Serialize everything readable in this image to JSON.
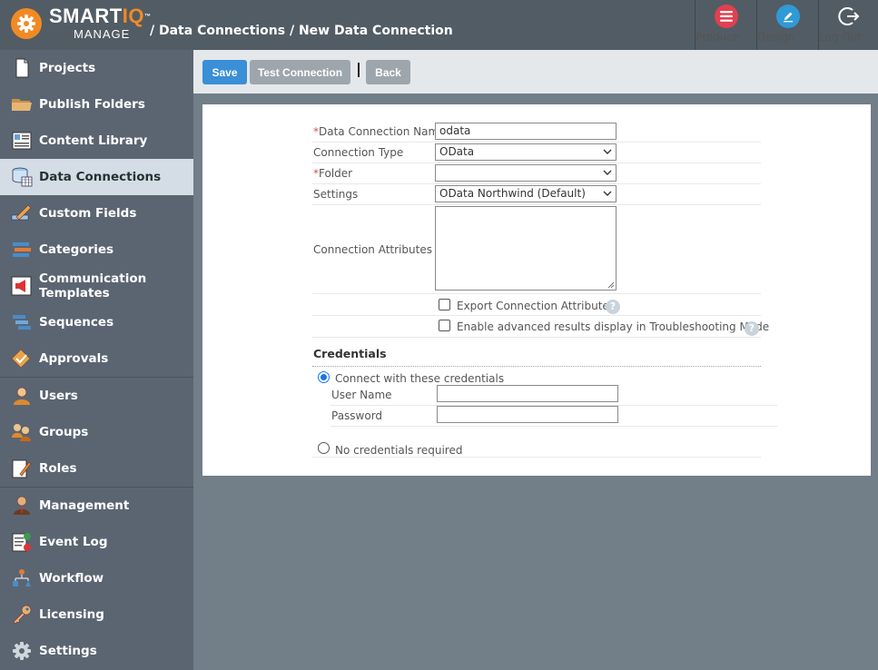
{
  "header": {
    "logo_word": "SMART",
    "logo_iq": "IQ",
    "logo_tm": "™",
    "logo_sub": "MANAGE",
    "breadcrumb": "/ Data Connections / New Data Connection",
    "buttons": [
      {
        "label": "Produce",
        "icon": "list-icon",
        "color": "#e0404f"
      },
      {
        "label": "Design",
        "icon": "pencil-icon",
        "color": "#2f9ad6"
      },
      {
        "label": "Log Out",
        "icon": "logout-icon",
        "color": "#525c64"
      }
    ]
  },
  "sidebar": {
    "items": [
      {
        "label": "Projects",
        "icon": "document-icon"
      },
      {
        "label": "Publish Folders",
        "icon": "folder-icon"
      },
      {
        "label": "Content Library",
        "icon": "library-icon"
      },
      {
        "label": "Data Connections",
        "icon": "database-icon",
        "active": true
      },
      {
        "label": "Custom Fields",
        "icon": "pencil-ruler-icon"
      },
      {
        "label": "Categories",
        "icon": "categories-icon"
      },
      {
        "label": "Communication Templates",
        "icon": "megaphone-icon"
      },
      {
        "label": "Sequences",
        "icon": "stack-icon"
      },
      {
        "label": "Approvals",
        "icon": "approval-icon"
      },
      {
        "label": "Users",
        "icon": "user-icon"
      },
      {
        "label": "Groups",
        "icon": "group-icon"
      },
      {
        "label": "Roles",
        "icon": "role-icon"
      },
      {
        "label": "Management",
        "icon": "manager-icon"
      },
      {
        "label": "Event Log",
        "icon": "event-log-icon"
      },
      {
        "label": "Workflow",
        "icon": "workflow-icon"
      },
      {
        "label": "Licensing",
        "icon": "key-icon"
      },
      {
        "label": "Settings",
        "icon": "gear-icon"
      }
    ]
  },
  "toolbar": {
    "save_label": "Save",
    "test_label": "Test Connection",
    "back_label": "Back"
  },
  "form": {
    "name_label": "Data Connection Name",
    "name_value": "odata",
    "type_label": "Connection Type",
    "type_value": "OData",
    "folder_label": "Folder",
    "folder_value": "",
    "settings_label": "Settings",
    "settings_value": "OData Northwind (Default)",
    "attributes_label": "Connection Attributes",
    "attributes_value": "",
    "export_label": "Export Connection Attributes",
    "advanced_label": "Enable advanced results display in Troubleshooting Mode",
    "required_mark": "*",
    "help_mark": "?"
  },
  "credentials": {
    "title": "Credentials",
    "connect_label": "Connect with these credentials",
    "username_label": "User Name",
    "username_value": "",
    "password_label": "Password",
    "password_value": "",
    "none_label": "No credentials required"
  },
  "colors": {
    "accent_blue": "#3a8fd6",
    "grey_button": "#9ea6ad",
    "logo_orange": "#f28a24"
  }
}
